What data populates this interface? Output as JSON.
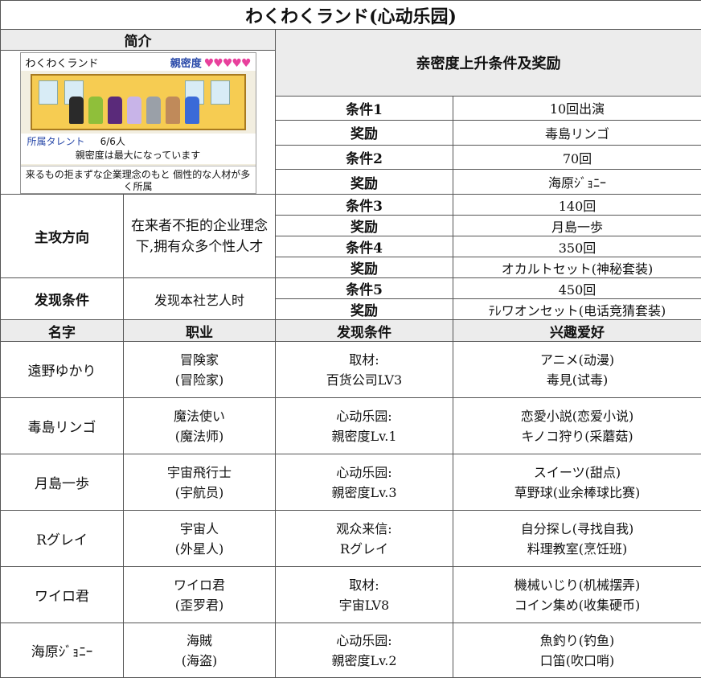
{
  "title": "わくわくランド(心动乐园)",
  "intro": {
    "header": "简介",
    "screenshot": {
      "name": "わくわくランド",
      "affinity_label": "親密度",
      "hearts": "♥♥♥♥♥",
      "talent_label": "所属タレント",
      "talent_count": "6/6人",
      "status": "親密度は最大になっています",
      "desc": "来るもの拒まずな企業理念のもと 個性的な人材が多く所属"
    }
  },
  "reward_header": "亲密度上升条件及奖励",
  "rewards": [
    {
      "label": "条件1",
      "value": "10回出演"
    },
    {
      "label": "奖励",
      "value": "毒島リンゴ"
    },
    {
      "label": "条件2",
      "value": "70回"
    },
    {
      "label": "奖励",
      "value": "海原ｼﾞｮﾆｰ"
    },
    {
      "label": "条件3",
      "value": "140回"
    },
    {
      "label": "奖励",
      "value": "月島一歩"
    },
    {
      "label": "条件4",
      "value": "350回"
    },
    {
      "label": "奖励",
      "value": "オカルトセット(神秘套装)"
    },
    {
      "label": "条件5",
      "value": "450回"
    },
    {
      "label": "奖励",
      "value": "ﾃﾚワオンセット(电话竞猜套装)"
    }
  ],
  "focus": {
    "label": "主攻方向",
    "value": "在来者不拒的企业理念下,拥有众多个性人才"
  },
  "discover": {
    "label": "发现条件",
    "value": "发现本社艺人时"
  },
  "columns": [
    "名字",
    "职业",
    "发现条件",
    "兴趣爱好"
  ],
  "members": [
    {
      "name": "遠野ゆかり",
      "job": "冒険家",
      "job_cn": "(冒险家)",
      "cond1": "取材:",
      "cond2": "百货公司LV3",
      "hobby1": "アニメ(动漫)",
      "hobby2": "毒見(试毒)"
    },
    {
      "name": "毒島リンゴ",
      "job": "魔法使い",
      "job_cn": "(魔法师)",
      "cond1": "心动乐园:",
      "cond2": "親密度Lv.1",
      "hobby1": "恋愛小説(恋爱小说)",
      "hobby2": "キノコ狩り(采蘑菇)"
    },
    {
      "name": "月島一歩",
      "job": "宇宙飛行士",
      "job_cn": "(宇航员)",
      "cond1": "心动乐园:",
      "cond2": "親密度Lv.3",
      "hobby1": "スイーツ(甜点)",
      "hobby2": "草野球(业余棒球比赛)"
    },
    {
      "name": "Rグレイ",
      "job": "宇宙人",
      "job_cn": "(外星人)",
      "cond1": "观众来信:",
      "cond2": "Rグレイ",
      "hobby1": "自分探し(寻找自我)",
      "hobby2": "料理教室(烹饪班)"
    },
    {
      "name": "ワイロ君",
      "job": "ワイロ君",
      "job_cn": "(歪罗君)",
      "cond1": "取材:",
      "cond2": "宇宙LV8",
      "hobby1": "機械いじり(机械摆弄)",
      "hobby2": "コイン集め(收集硬币)"
    },
    {
      "name": "海原ｼﾞｮﾆｰ",
      "job": "海賊",
      "job_cn": "(海盗)",
      "cond1": "心动乐园:",
      "cond2": "親密度Lv.2",
      "hobby1": "魚釣り(钓鱼)",
      "hobby2": "口笛(吹口哨)"
    }
  ],
  "colors": {
    "header_bg": "#ececec",
    "heart": "#e8409c",
    "stage": "#f6cc52",
    "label_blue": "#2848a8"
  }
}
